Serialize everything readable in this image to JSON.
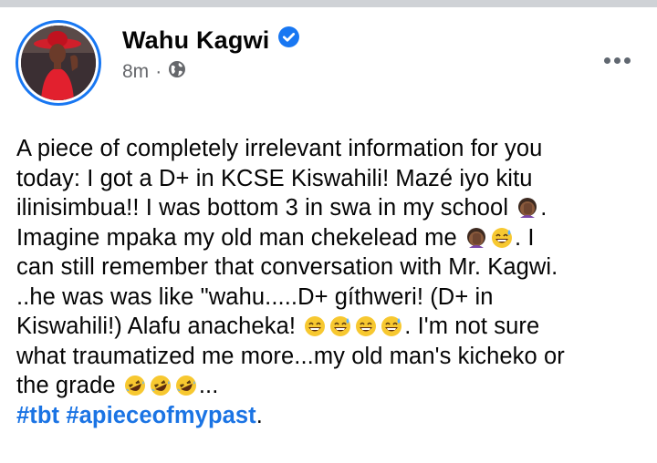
{
  "post": {
    "author": "Wahu Kagwi",
    "verified_icon": "verified-badge-icon",
    "timestamp": "8m",
    "separator": "·",
    "audience_icon": "globe-icon",
    "more_icon": "more-options-icon",
    "accent_color": "#1877f2",
    "lines": [
      "A piece of completely irrelevant information for you",
      "today: I got a D+ in KCSE Kiswahili! Mazé iyo kitu",
      "ilinisimbua!! I was bottom 3 in swa in my school",
      "Imagine mpaka my old man chekelead me",
      "can still remember that conversation with Mr. Kagwi.",
      "..he was was like \"wahu.....D+ gíthweri! (D+ in",
      "Kiswahili!) Alafu anacheka!",
      "what traumatized me more...my old man's kicheko or",
      "the grade"
    ],
    "line3_end": ".",
    "line4_end": ". I",
    "line7_end": ". I'm not sure",
    "line9_end": "...",
    "hashtags": [
      "#tbt",
      "#apieceofmypast"
    ],
    "hashtag_end": ".",
    "emojis": {
      "facepalm": "woman-facepalming-emoji",
      "sweat_smile": "grinning-sweat-emoji",
      "grin": "grinning-squinting-emoji",
      "rofl": "rolling-on-floor-laughing-emoji"
    }
  }
}
